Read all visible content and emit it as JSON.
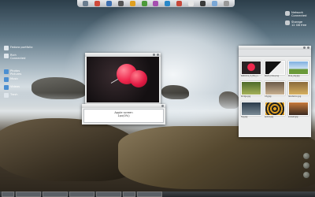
{
  "desktop": {
    "widgets": [
      {
        "label": "Fedora portfolio",
        "icon": "home-icon",
        "sub": ""
      },
      {
        "label": "Rich",
        "icon": "user-icon",
        "sub": "Connected"
      },
      {
        "label": "Photos",
        "icon": "folder-icon",
        "sub": "Pictures"
      },
      {
        "label": "Music",
        "icon": "folder-icon",
        "sub": ""
      },
      {
        "label": "Videos",
        "icon": "folder-icon",
        "sub": ""
      },
      {
        "label": "Trash",
        "icon": "trash-icon",
        "sub": ""
      }
    ],
    "right_widgets": [
      {
        "label": "Network",
        "sub": "Connected"
      },
      {
        "label": "Storage",
        "sub": "12 GB free"
      }
    ]
  },
  "dialog": {
    "line1": "Apple screen",
    "line2": "1px(0%)"
  },
  "file_manager": {
    "captions": [
      "balloons_in_the_s...",
      "black_hole.png",
      "blue_sky.jpg",
      "bridge.jpg",
      "city.jpg",
      "dandelion.jpg",
      "fog.jpg",
      "spiral.jpg",
      "sunset.jpg"
    ]
  },
  "colors": {
    "balloon": "#f0284e",
    "dock": "#d9dcdf",
    "taskbar": "#2e3235"
  }
}
